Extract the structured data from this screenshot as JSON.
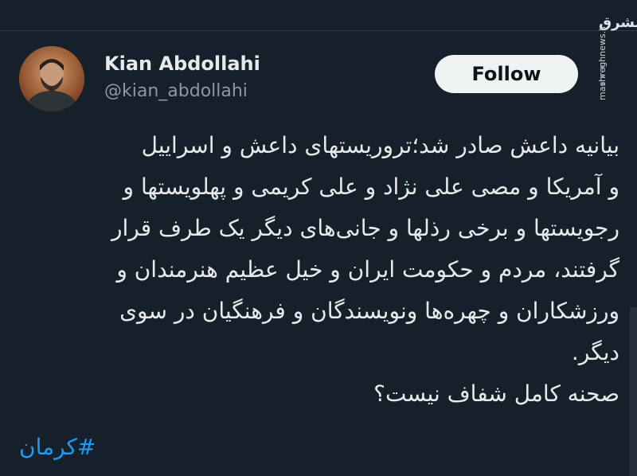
{
  "watermark": {
    "logo": "مشرق",
    "site": "mashreghnews.ir"
  },
  "author": {
    "name": "Kian Abdollahi",
    "handle": "@kian_abdollahi"
  },
  "actions": {
    "follow_label": "Follow",
    "more_icon": "more-dots-icon"
  },
  "tweet": {
    "lines": [
      "بیانیه داعش صادر شد؛تروریستهای داعش و اسراییل",
      "و آمریکا و مصی علی نژاد و علی کریمی و پهلویستها و",
      "رجویستها و برخی رذلها و جانی‌های دیگر یک طرف قرار",
      "گرفتند، مردم و حکومت ایران و خیل عظیم هنرمندان و",
      "ورزشکاران و چهره‌ها ونویسندگان و فرهنگیان در سوی",
      "دیگر.",
      "صحنه کامل شفاف نیست؟"
    ],
    "hashtag": "#کرمان"
  },
  "colors": {
    "background": "#15202b",
    "text": "#e7e9ea",
    "muted": "#8b98a5",
    "link": "#1d9bf0",
    "follow_bg": "#eff3f4"
  }
}
